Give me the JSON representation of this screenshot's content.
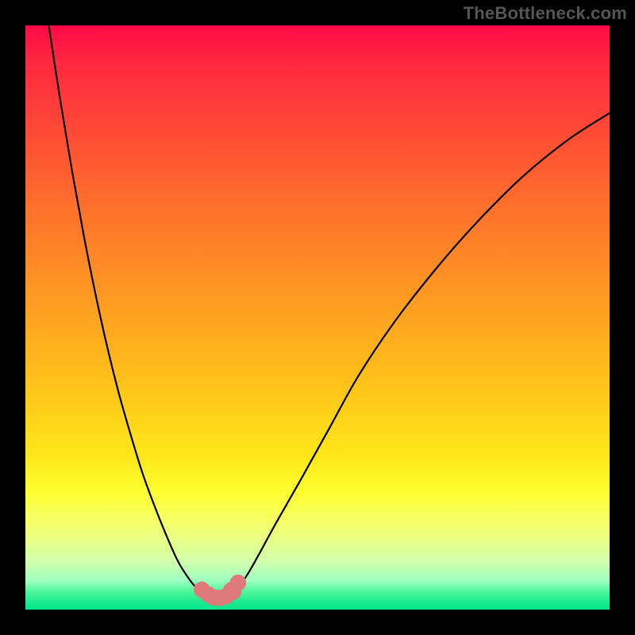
{
  "watermark": "TheBottleneck.com",
  "chart_data": {
    "type": "line",
    "title": "",
    "xlabel": "",
    "ylabel": "",
    "xlim": [
      0,
      100
    ],
    "ylim": [
      0,
      100
    ],
    "series": [
      {
        "name": "left-curve",
        "x": [
          4,
          6,
          8,
          10,
          12,
          14,
          16,
          18,
          20,
          22,
          24,
          26,
          27.5,
          29,
          30,
          31
        ],
        "values": [
          100,
          87,
          75,
          64,
          54,
          45,
          37,
          30,
          23.5,
          18,
          13,
          8.5,
          6,
          4,
          3.2,
          2.8
        ]
      },
      {
        "name": "right-curve",
        "x": [
          35,
          36.5,
          38,
          40,
          43,
          47,
          52,
          57,
          63,
          70,
          77,
          85,
          93,
          100
        ],
        "values": [
          2.8,
          4,
          6,
          9.5,
          15,
          22,
          31,
          40,
          49,
          58,
          66,
          74,
          80.5,
          85
        ]
      },
      {
        "name": "trough",
        "x": [
          31,
          31.5,
          32,
          33,
          34,
          34.5,
          35
        ],
        "values": [
          2.8,
          2.3,
          2.0,
          1.9,
          2.0,
          2.3,
          2.8
        ]
      }
    ],
    "markers": [
      {
        "x": 30.2,
        "y": 3.4,
        "r": 1.4
      },
      {
        "x": 31.3,
        "y": 2.6,
        "r": 1.4
      },
      {
        "x": 32.2,
        "y": 2.1,
        "r": 1.4
      },
      {
        "x": 33.3,
        "y": 2.0,
        "r": 1.4
      },
      {
        "x": 34.4,
        "y": 2.3,
        "r": 1.4
      },
      {
        "x": 35.4,
        "y": 3.2,
        "r": 1.6
      },
      {
        "x": 36.4,
        "y": 4.6,
        "r": 1.4
      }
    ],
    "colors": {
      "curve": "#000000",
      "marker": "#e07a7a",
      "gradient_top": "#ff0a47",
      "gradient_bottom": "#05e68c",
      "background": "#000000",
      "watermark": "#555555"
    }
  }
}
